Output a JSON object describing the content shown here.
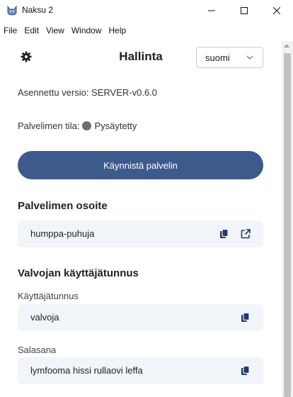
{
  "window": {
    "title": "Naksu 2",
    "icon": "naksu-cat-icon"
  },
  "menu": [
    "File",
    "Edit",
    "View",
    "Window",
    "Help"
  ],
  "header": {
    "title": "Hallinta",
    "language": "suomi"
  },
  "info": {
    "installed_version": "Asennettu versio: SERVER-v0.6.0",
    "server_status_label": "Palvelimen tila:",
    "server_status_value": "Pysäytetty"
  },
  "actions": {
    "start_server": "Käynnistä palvelin"
  },
  "address_section": {
    "heading": "Palvelimen osoite",
    "value": "humppa-puhuja"
  },
  "credentials_section": {
    "heading": "Valvojan käyttäjätunnus",
    "username_label": "Käyttäjätunnus",
    "username_value": "valvoja",
    "password_label": "Salasana",
    "password_value": "lymfooma hissi rullaovi leffa"
  },
  "colors": {
    "primary_button": "#3d5a8c",
    "card_background": "#f1f5fa",
    "status_stopped": "#6e6e6e"
  }
}
